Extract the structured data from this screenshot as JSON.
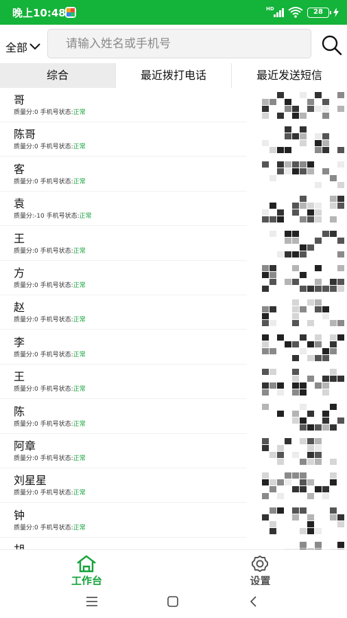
{
  "status": {
    "time": "晚上10:48",
    "network": "HD",
    "battery": "28"
  },
  "search": {
    "scope": "全部",
    "placeholder": "请输入姓名或手机号"
  },
  "tabs": [
    {
      "label": "综合"
    },
    {
      "label": "最近拨打电话"
    },
    {
      "label": "最近发送短信"
    }
  ],
  "labels": {
    "score": "质量分:",
    "phone_status": "手机号状态:"
  },
  "contacts": [
    {
      "name": "哥",
      "score": "0",
      "status": "正常"
    },
    {
      "name": "陈哥",
      "score": "0",
      "status": "正常"
    },
    {
      "name": "客",
      "score": "0",
      "status": "正常"
    },
    {
      "name": "袁",
      "score": "-10",
      "status": "正常"
    },
    {
      "name": "王",
      "score": "0",
      "status": "正常"
    },
    {
      "name": "方",
      "score": "0",
      "status": "正常"
    },
    {
      "name": "赵",
      "score": "0",
      "status": "正常"
    },
    {
      "name": "李",
      "score": "0",
      "status": "正常"
    },
    {
      "name": "王",
      "score": "0",
      "status": "正常"
    },
    {
      "name": "陈",
      "score": "0",
      "status": "正常"
    },
    {
      "name": "阿章",
      "score": "0",
      "status": "正常"
    },
    {
      "name": "刘星星",
      "score": "0",
      "status": "正常"
    },
    {
      "name": "钟",
      "score": "0",
      "status": "正常"
    },
    {
      "name": "胡",
      "score": "",
      "status": ""
    }
  ],
  "tabbar": [
    {
      "label": "工作台",
      "color": "#14a33a"
    },
    {
      "label": "设置",
      "color": "#555555"
    }
  ],
  "colors": {
    "accent": "#14b33a",
    "ok": "#14a33a"
  },
  "icons": {
    "search": "search-icon",
    "home": "home-icon",
    "settings": "gear-icon"
  }
}
